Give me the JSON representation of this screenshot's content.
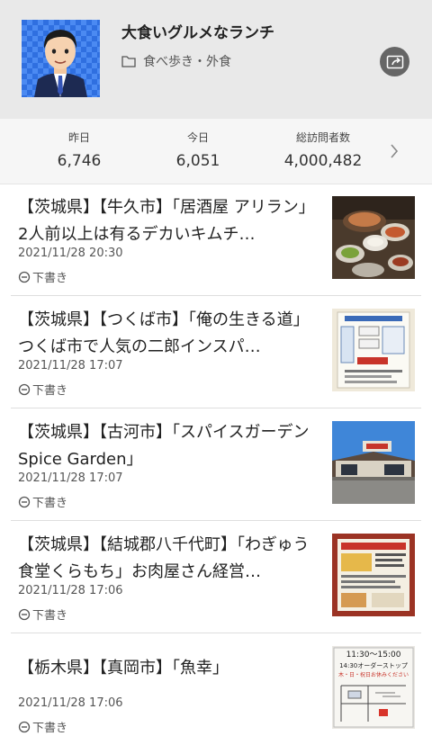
{
  "header": {
    "blog_title": "大食いグルメなランチ",
    "category": "食べ歩き・外食"
  },
  "stats": {
    "yesterday": {
      "label": "昨日",
      "value": "6,746"
    },
    "today": {
      "label": "今日",
      "value": "6,051"
    },
    "total": {
      "label": "総訪問者数",
      "value": "4,000,482"
    }
  },
  "posts": [
    {
      "title": "【茨城県】【牛久市】「居酒屋 アリラン」2人前以上は有るデカいキムチ…",
      "date": "2021/11/28 20:30",
      "status": "下書き"
    },
    {
      "title": "【茨城県】【つくば市】「俺の生きる道」つくば市で人気の二郎インスパ…",
      "date": "2021/11/28 17:07",
      "status": "下書き"
    },
    {
      "title": "【茨城県】【古河市】「スパイスガーデン Spice Garden」",
      "date": "2021/11/28 17:07",
      "status": "下書き"
    },
    {
      "title": "【茨城県】【結城郡八千代町】「わぎゅう食堂くらもち」お肉屋さん経営…",
      "date": "2021/11/28 17:06",
      "status": "下書き"
    },
    {
      "title": "【栃木県】【真岡市】「魚幸」",
      "date": "2021/11/28 17:06",
      "status": "下書き"
    }
  ],
  "thumbs": {
    "sign_text_1": "11:30～15:00",
    "sign_text_2": "14:30オーダーストップ",
    "sign_text_3": "木・日・祝日お休みください"
  }
}
